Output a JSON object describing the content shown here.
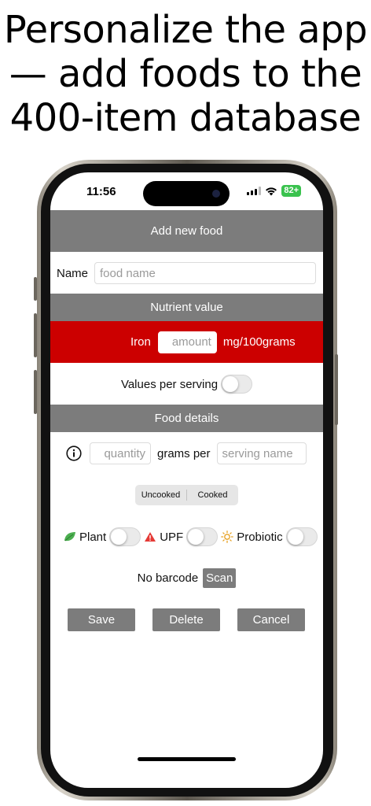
{
  "headline": {
    "line1": "Personalize the app",
    "line2": "— add foods to the",
    "line3": "400-item database"
  },
  "status_bar": {
    "time": "11:56",
    "battery": "82+"
  },
  "screen": {
    "title": "Add new food",
    "name_label": "Name",
    "name_placeholder": "food name",
    "nutrient_section": "Nutrient value",
    "nutrient_name": "Iron",
    "amount_placeholder": "amount",
    "amount_unit": "mg/100grams",
    "values_per_serving_label": "Values per serving",
    "food_details_section": "Food details",
    "quantity_placeholder": "quantity",
    "grams_per_label": "grams per",
    "serving_name_placeholder": "serving name",
    "segments": [
      "Uncooked",
      "Cooked"
    ],
    "plant_label": "Plant",
    "upf_label": "UPF",
    "probiotic_label": "Probiotic",
    "barcode_label": "No barcode",
    "scan_label": "Scan",
    "save_label": "Save",
    "delete_label": "Delete",
    "cancel_label": "Cancel"
  },
  "colors": {
    "header_gray": "#7c7c7c",
    "nutrient_red": "#cc0000",
    "plant_green": "#4caf50",
    "upf_red": "#e53935",
    "probiotic_orange": "#e6a020"
  }
}
